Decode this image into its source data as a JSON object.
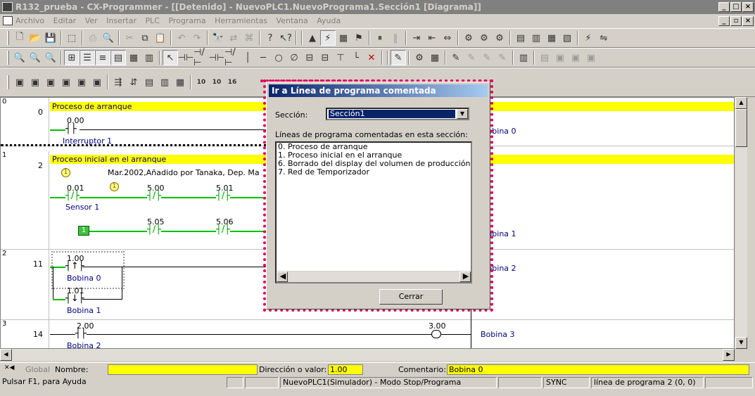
{
  "window": {
    "title": "R132_prueba - CX-Programmer - [[Detenido] - NuevoPLC1.NuevoPrograma1.Sección1 [Diagrama]]"
  },
  "menu": [
    "Archivo",
    "Editar",
    "Ver",
    "Insertar",
    "PLC",
    "Programa",
    "Herramientas",
    "Ventana",
    "Ayuda"
  ],
  "rungs": [
    {
      "num": "0",
      "step": "0",
      "comment": "Proceso de arranque",
      "contact_addr": "0.00",
      "contact_sym": "Interruptor 1",
      "coil_sym": "Bobina 0"
    },
    {
      "num": "1",
      "step": "2",
      "comment": "Proceso inicial en el arranque",
      "note_marker": "1",
      "note_text": "Mar.2002,Añadido por Tanaka, Dep. Ma",
      "row1_addrs": [
        "0.01",
        "5.00",
        "5.01"
      ],
      "row1_marker": "1",
      "row1_sym": "Sensor 1",
      "row2_label": "1",
      "row2_addrs": [
        "5.05",
        "5.06"
      ],
      "coil_sym": "Bobina 1"
    },
    {
      "num": "2",
      "step": "11",
      "addrs": [
        "1.00",
        "1.01"
      ],
      "syms": [
        "Bobina 0",
        "Bobina 1"
      ],
      "coil_sym": "Bobina 2"
    },
    {
      "num": "3",
      "step": "14",
      "addr": "2.00",
      "sym": "Bobina 2",
      "coil_addr": "3.00",
      "coil_sym": "Bobina 3"
    }
  ],
  "zoom_labels": [
    "10",
    "10",
    "16"
  ],
  "dialog": {
    "title": "Ir a Línea de programa comentada",
    "section_label": "Sección:",
    "section_value": "Sección1",
    "list_label": "Líneas de programa comentadas en esta sección:",
    "items": [
      "0. Proceso de arranque",
      "1. Proceso inicial en el arranque",
      "6. Borrado del display del volumen de producción",
      "7. Red de Temporizador"
    ],
    "close_label": "Cerrar"
  },
  "infobar": {
    "global_label": "Global",
    "name_label": "Nombre:",
    "name_value": "",
    "addr_label": "Dirección o valor:",
    "addr_value": "1.00",
    "comment_label": "Comentario:",
    "comment_value": "Bobina 0"
  },
  "status": {
    "help": "Pulsar F1, para Ayuda",
    "plc": "NuevoPLC1(Simulador) - Modo Stop/Programa",
    "sync": "SYNC",
    "line": "línea de programa 2 (0, 0)"
  },
  "colors": {
    "comment_bg": "#ffff00",
    "wire": "#00c000",
    "dialog_border": "#e0005a",
    "title_active": "#0a246a"
  }
}
